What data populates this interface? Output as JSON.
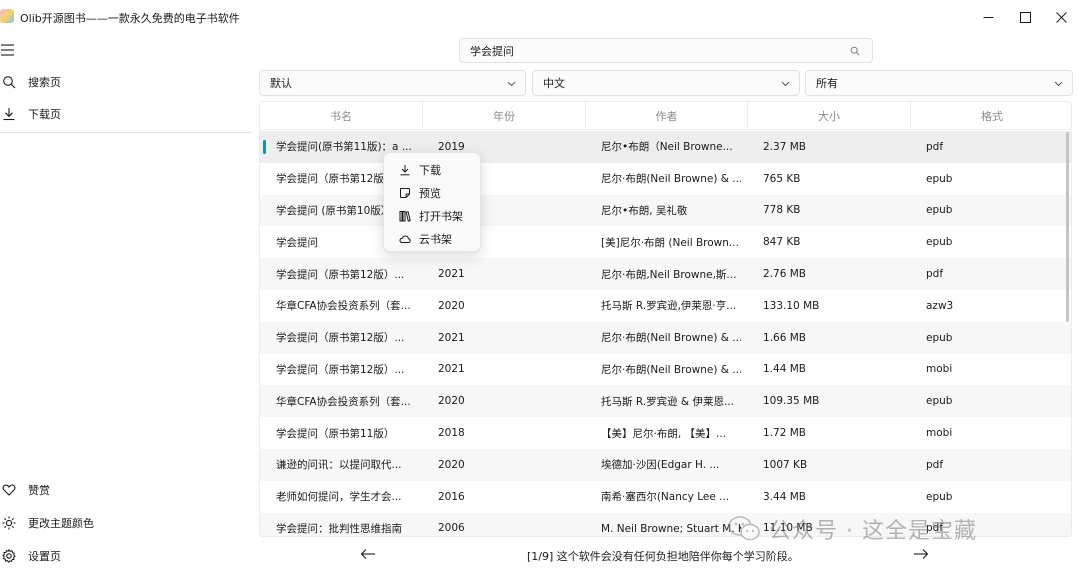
{
  "window": {
    "title": "Olib开源图书——一款永久免费的电子书软件",
    "controls": [
      "minimize-icon",
      "maximize-icon",
      "close-icon"
    ]
  },
  "sidebar": {
    "top_items": [
      {
        "label": "搜索页",
        "icon": "search-icon"
      },
      {
        "label": "下载页",
        "icon": "download-icon"
      }
    ],
    "bottom_items": [
      {
        "label": "赞赏",
        "icon": "heart-icon"
      },
      {
        "label": "更改主题颜色",
        "icon": "brightness-icon"
      },
      {
        "label": "设置页",
        "icon": "gear-icon"
      }
    ]
  },
  "search": {
    "value": "学会提问",
    "placeholder": ""
  },
  "filters": {
    "sort": "默认",
    "language": "中文",
    "format": "所有"
  },
  "table": {
    "columns": [
      "书名",
      "年份",
      "作者",
      "大小",
      "格式"
    ],
    "rows": [
      [
        "学会提问(原书第11版)：a ...",
        "2019",
        "尼尔•布朗（Neil Browne...",
        "2.37 MB",
        "pdf"
      ],
      [
        "学会提问（原书第12版）...",
        "",
        "尼尔·布朗(Neil Browne) & ...",
        "765 KB",
        "epub"
      ],
      [
        "学会提问 (原书第10版）...",
        "",
        "尼尔•布朗, 吴礼敬",
        "778 KB",
        "epub"
      ],
      [
        "学会提问",
        "",
        "[美]尼尔·布朗 (Neil Brown...",
        "847 KB",
        "epub"
      ],
      [
        "学会提问（原书第12版）...",
        "2021",
        "尼尔·布朗,Neil Browne,斯...",
        "2.76 MB",
        "pdf"
      ],
      [
        "华章CFA协会投资系列（套...",
        "2020",
        "托马斯 R.罗宾逊,伊莱恩·亨...",
        "133.10 MB",
        "azw3"
      ],
      [
        "学会提问（原书第12版）...",
        "2021",
        "尼尔·布朗(Neil Browne) & ...",
        "1.66 MB",
        "epub"
      ],
      [
        "学会提问（原书第12版）...",
        "2021",
        "尼尔·布朗(Neil Browne) & ...",
        "1.44 MB",
        "mobi"
      ],
      [
        "华章CFA协会投资系列（套...",
        "2020",
        "托马斯 R.罗宾逊 & 伊莱恩...",
        "109.35 MB",
        "epub"
      ],
      [
        "学会提问（原书第11版）",
        "2018",
        "【美】尼尔·布朗, 【美】...",
        "1.72 MB",
        "mobi"
      ],
      [
        "谦逊的问讯：以提问取代...",
        "2020",
        "埃德加·沙因(Edgar H. ...",
        "1007 KB",
        "pdf"
      ],
      [
        "老师如何提问，学生才会...",
        "2016",
        "南希·塞西尔(Nancy Lee ...",
        "3.44 MB",
        "epub"
      ],
      [
        "学会提问：批判性思维指南",
        "2006",
        "M. Neil Browne; Stuart M. Keeley; 赵玉芳; 向晋辉",
        "11.10 MB",
        "pdf"
      ]
    ],
    "selected_row": 0
  },
  "context_menu": {
    "items": [
      {
        "label": "下载",
        "icon": "download-icon"
      },
      {
        "label": "预览",
        "icon": "preview-icon"
      },
      {
        "label": "打开书架",
        "icon": "bookshelf-icon"
      },
      {
        "label": "云书架",
        "icon": "cloud-icon"
      }
    ]
  },
  "footer": {
    "status": "[1/9] 这个软件会没有任何负担地陪伴你每个学习阶段。"
  },
  "watermark": {
    "text": "公众号 · 这全是宝藏",
    "icon": "wechat-icon"
  }
}
